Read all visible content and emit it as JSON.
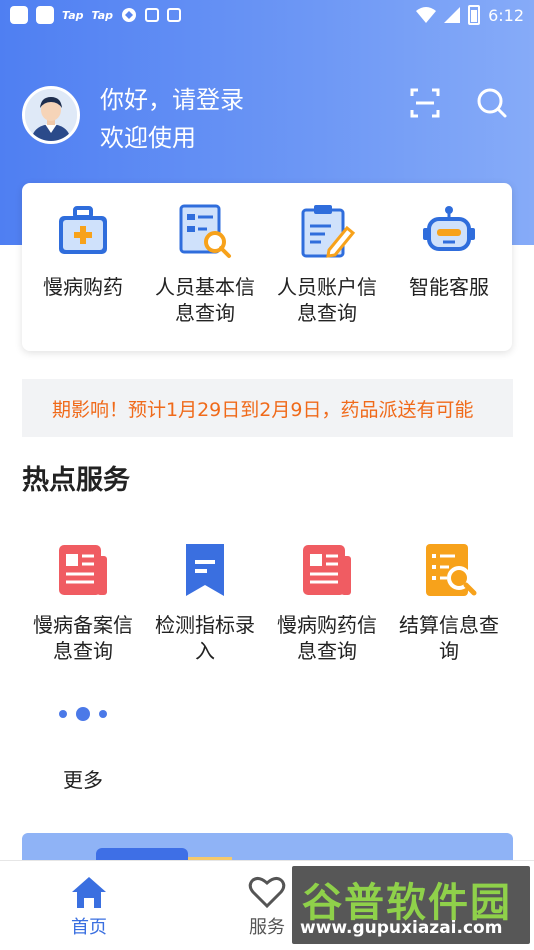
{
  "status_bar": {
    "tap1": "Tap",
    "tap2": "Tap",
    "time": "6:12",
    "icons": [
      "app-square-icon",
      "app-square-icon",
      "taptap-icon",
      "taptap-icon",
      "refresh-icon",
      "message-icon",
      "font-icon",
      "wifi-icon",
      "signal-icon",
      "battery-icon"
    ]
  },
  "header": {
    "greeting": "你好，请登录",
    "welcome": "欢迎使用",
    "icons": [
      "avatar",
      "scan-icon",
      "search-icon"
    ]
  },
  "quick_menu": [
    {
      "label": "慢病购药",
      "icon": "medicine-box-icon"
    },
    {
      "label": "人员基本信息查询",
      "icon": "info-search-icon"
    },
    {
      "label": "人员账户信息查询",
      "icon": "account-edit-icon"
    },
    {
      "label": "智能客服",
      "icon": "robot-icon"
    }
  ],
  "notice": {
    "text": "期影响！预计1月29日到2月9日，药品派送有可能"
  },
  "hot_services": {
    "title": "热点服务",
    "items": [
      {
        "label": "慢病备案信息查询",
        "icon": "document-icon"
      },
      {
        "label": "检测指标录入",
        "icon": "bookmark-icon"
      },
      {
        "label": "慢病购药信息查询",
        "icon": "document-icon"
      },
      {
        "label": "结算信息查询",
        "icon": "list-search-icon"
      }
    ],
    "more_label": "更多"
  },
  "tabbar": {
    "tabs": [
      {
        "label": "首页",
        "icon": "home-icon",
        "active": true
      },
      {
        "label": "服务",
        "icon": "heart-icon",
        "active": false
      }
    ]
  },
  "watermark": {
    "cn": "谷普软件园",
    "url": "www.gupuxiazai.com"
  },
  "colors": {
    "primary": "#4b79e8",
    "hero_start": "#4f7ff2",
    "hero_end": "#86abf8",
    "notice_text": "#f06a1a",
    "doc_red": "#f05c62",
    "orange": "#f7a21b"
  }
}
